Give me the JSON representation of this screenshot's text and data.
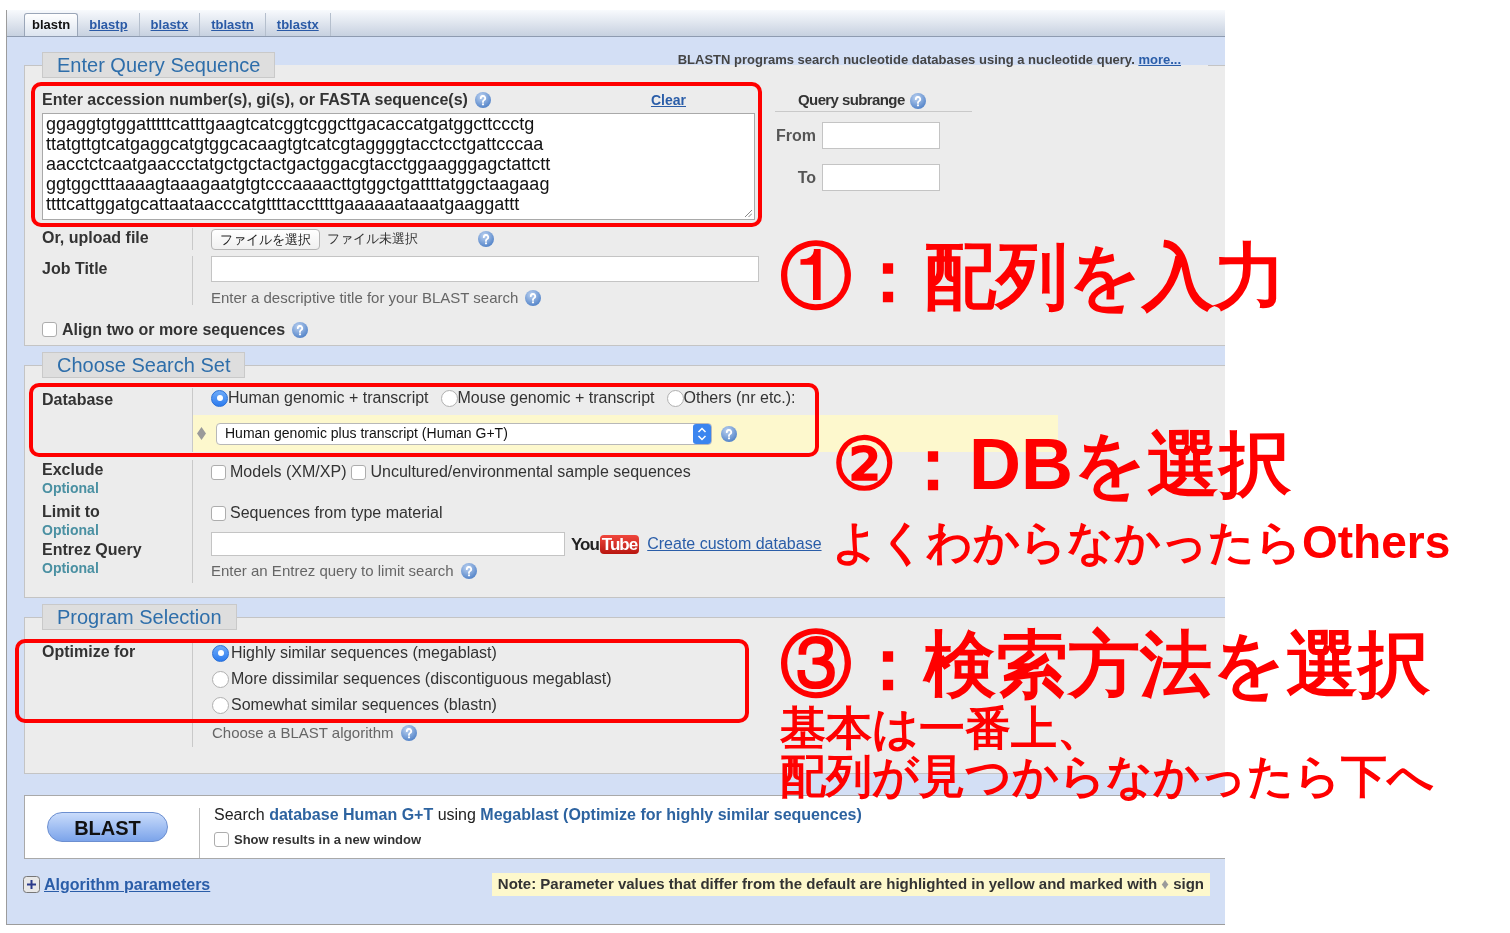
{
  "tabs": [
    {
      "label": "blastn",
      "selected": true
    },
    {
      "label": "blastp",
      "selected": false
    },
    {
      "label": "blastx",
      "selected": false
    },
    {
      "label": "tblastn",
      "selected": false
    },
    {
      "label": "tblastx",
      "selected": false
    }
  ],
  "description": {
    "text": "BLASTN programs search nucleotide databases using a nucleotide query.",
    "link": "more..."
  },
  "query_section": {
    "title": "Enter Query Sequence",
    "sequence_label": "Enter accession number(s), gi(s), or FASTA sequence(s)",
    "clear_link": "Clear",
    "sequence_lines": [
      "ggaggtgtggatttttcatttgaagtcatcggtcggcttgacaccatgatggcttccctg",
      "ttatgttgtcatgaggcatgtggcacaagtgtcatcgtaggggtacctcctgattcccaa",
      "aacctctcaatgaaccctatgctgctactgactggacgtacctggaagggagctattctt",
      "ggtggctttaaaagtaaagaatgtgtcccaaaacttgtggctgattttatggctaagaag",
      "ttttcattggatgcattaataacccatgttttaccttttgaaaaaataaatgaaggattt"
    ],
    "subrange": {
      "title": "Query subrange",
      "from_label": "From",
      "to_label": "To"
    },
    "upload": {
      "label": "Or, upload file",
      "button": "ファイルを選択",
      "status": "ファイル未選択"
    },
    "job_title": {
      "label": "Job Title",
      "hint": "Enter a descriptive title for your BLAST search"
    },
    "align": {
      "label": "Align two or more sequences",
      "checked": false
    }
  },
  "search_set": {
    "title": "Choose Search Set",
    "database": {
      "label": "Database",
      "options": [
        {
          "label": "Human genomic + transcript",
          "selected": true
        },
        {
          "label": "Mouse genomic + transcript",
          "selected": false
        },
        {
          "label": "Others (nr etc.):",
          "selected": false
        }
      ],
      "select_value": "Human genomic plus transcript (Human G+T)",
      "modified": true
    },
    "exclude": {
      "label": "Exclude",
      "optional": "Optional",
      "options": [
        {
          "label": "Models (XM/XP)",
          "checked": false
        },
        {
          "label": "Uncultured/environmental sample sequences",
          "checked": false
        }
      ]
    },
    "limit": {
      "label": "Limit to",
      "optional": "Optional",
      "options": [
        {
          "label": "Sequences from type material",
          "checked": false
        }
      ]
    },
    "entrez": {
      "label": "Entrez Query",
      "optional": "Optional",
      "logo": {
        "part_1": "You",
        "part_2": "Tube"
      },
      "link": "Create custom database",
      "hint": "Enter an Entrez query to limit search"
    }
  },
  "program": {
    "title": "Program Selection",
    "label": "Optimize for",
    "options": [
      {
        "label": "Highly similar sequences (megablast)",
        "selected": true
      },
      {
        "label": "More dissimilar sequences (discontiguous megablast)",
        "selected": false
      },
      {
        "label": "Somewhat similar sequences (blastn)",
        "selected": false
      }
    ],
    "hint": "Choose a BLAST algorithm"
  },
  "submit": {
    "button": "BLAST",
    "summary": [
      {
        "text": "Search",
        "kind": "plain"
      },
      {
        "text": "database Human G+T",
        "kind": "highlight"
      },
      {
        "text": "using",
        "kind": "plain"
      },
      {
        "text": "Megablast (Optimize for highly similar sequences)",
        "kind": "highlight"
      }
    ],
    "new_window": {
      "label": "Show results in a new window",
      "checked": false
    }
  },
  "algorithm_parameters": {
    "label": "Algorithm parameters",
    "expanded": false
  },
  "note": {
    "before": "Note: Parameter values that differ from the default are highlighted in yellow and marked with",
    "sign": "♦",
    "after": "sign"
  },
  "annotations": [
    {
      "heading": "①：配列を入力"
    },
    {
      "heading": "②：DBを選択",
      "notes": [
        "よくわからなかったらOthers"
      ]
    },
    {
      "heading": "③：検索方法を選択",
      "notes": [
        "基本は一番上、",
        "配列が見つからなかったら下へ"
      ]
    }
  ]
}
